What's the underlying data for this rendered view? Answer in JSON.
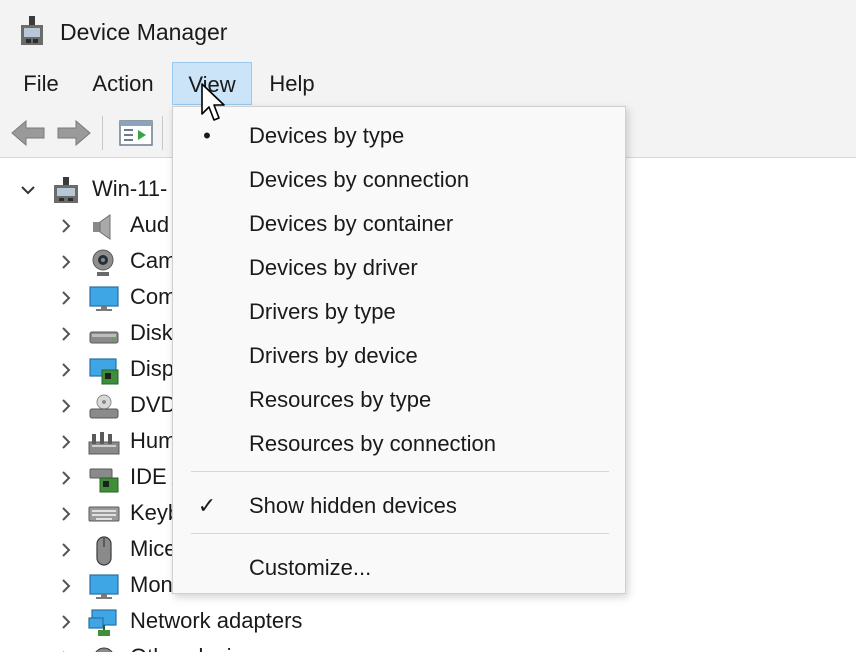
{
  "window": {
    "title": "Device Manager"
  },
  "menubar": {
    "items": [
      "File",
      "Action",
      "View",
      "Help"
    ],
    "active": "View"
  },
  "toolbar": {
    "buttons": [
      "back-arrow-icon",
      "forward-arrow-icon",
      "properties-icon"
    ]
  },
  "tree": {
    "root": {
      "label": "Win-11-",
      "expanded": true
    },
    "items": [
      {
        "label": "Aud",
        "icon": "speaker-icon"
      },
      {
        "label": "Cam",
        "icon": "webcam-icon"
      },
      {
        "label": "Com",
        "icon": "monitor-icon"
      },
      {
        "label": "Disk",
        "icon": "disk-drive-icon"
      },
      {
        "label": "Disp",
        "icon": "display-adapter-icon"
      },
      {
        "label": "DVD",
        "icon": "dvd-drive-icon"
      },
      {
        "label": "Hum",
        "icon": "hid-icon"
      },
      {
        "label": "IDE A",
        "icon": "ide-controller-icon"
      },
      {
        "label": "Keyb",
        "icon": "keyboard-icon"
      },
      {
        "label": "Mice",
        "icon": "mouse-icon"
      },
      {
        "label": "Mon",
        "icon": "monitor-icon"
      },
      {
        "label": "Network adapters",
        "icon": "network-adapter-icon"
      },
      {
        "label": "Other devices",
        "icon": "other-devices-icon"
      }
    ]
  },
  "view_menu": {
    "items": [
      {
        "label": "Devices by type",
        "mark": "•"
      },
      {
        "label": "Devices by connection",
        "mark": ""
      },
      {
        "label": "Devices by container",
        "mark": ""
      },
      {
        "label": "Devices by driver",
        "mark": ""
      },
      {
        "label": "Drivers by type",
        "mark": ""
      },
      {
        "label": "Drivers by device",
        "mark": ""
      },
      {
        "label": "Resources by type",
        "mark": ""
      },
      {
        "label": "Resources by connection",
        "mark": ""
      }
    ],
    "show_hidden": {
      "label": "Show hidden devices",
      "mark": "✓"
    },
    "customize": {
      "label": "Customize..."
    }
  },
  "colors": {
    "menu_highlight": "#cce4f7",
    "chrome_bg": "#f3f3f3",
    "menu_bg": "#f9f9f9"
  }
}
